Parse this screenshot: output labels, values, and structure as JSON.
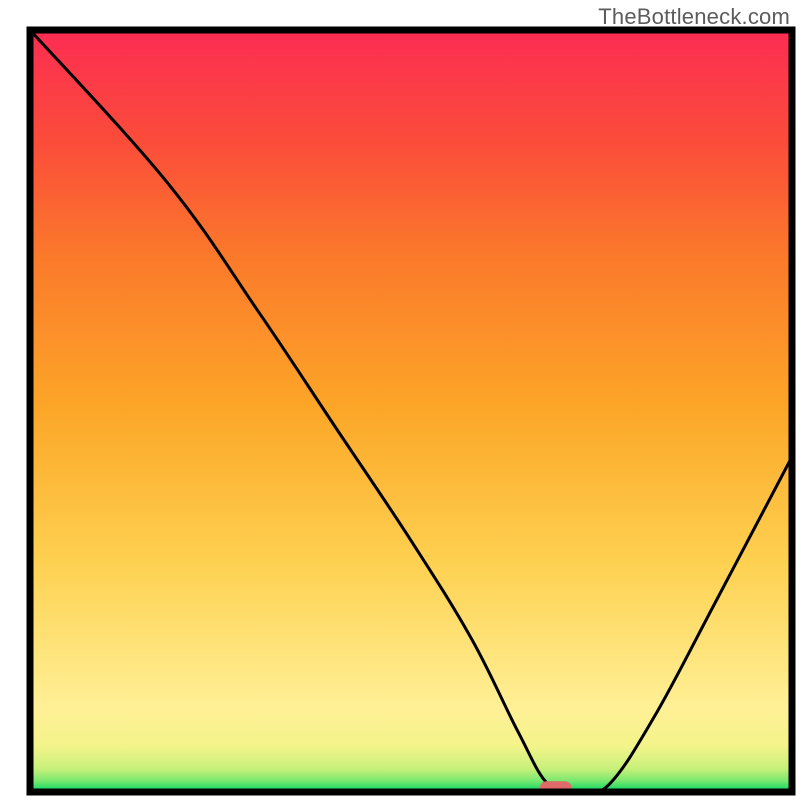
{
  "watermark": "TheBottleneck.com",
  "chart_data": {
    "type": "line",
    "title": "",
    "xlabel": "",
    "ylabel": "",
    "xlim": [
      0,
      100
    ],
    "ylim": [
      0,
      100
    ],
    "series": [
      {
        "name": "bottleneck-curve",
        "x": [
          0,
          18,
          30,
          40,
          50,
          58,
          64,
          68,
          72,
          76,
          82,
          90,
          100
        ],
        "values": [
          100,
          80,
          63,
          48,
          33,
          20,
          8,
          1,
          0,
          1,
          10,
          25,
          44
        ]
      }
    ],
    "marker": {
      "name": "optimal-point",
      "x": 69,
      "y": 0.5,
      "color": "#e06a6a"
    },
    "gradient_stops": [
      {
        "offset": 0.0,
        "color": "#00d463"
      },
      {
        "offset": 0.015,
        "color": "#7be86f"
      },
      {
        "offset": 0.03,
        "color": "#c6f07a"
      },
      {
        "offset": 0.06,
        "color": "#f3f48a"
      },
      {
        "offset": 0.11,
        "color": "#fff096"
      },
      {
        "offset": 0.3,
        "color": "#fed151"
      },
      {
        "offset": 0.5,
        "color": "#fca728"
      },
      {
        "offset": 0.7,
        "color": "#fb7a2a"
      },
      {
        "offset": 0.85,
        "color": "#fb4d3a"
      },
      {
        "offset": 1.0,
        "color": "#fc2c52"
      }
    ],
    "frame_color": "#000000",
    "line_color": "#000000"
  }
}
